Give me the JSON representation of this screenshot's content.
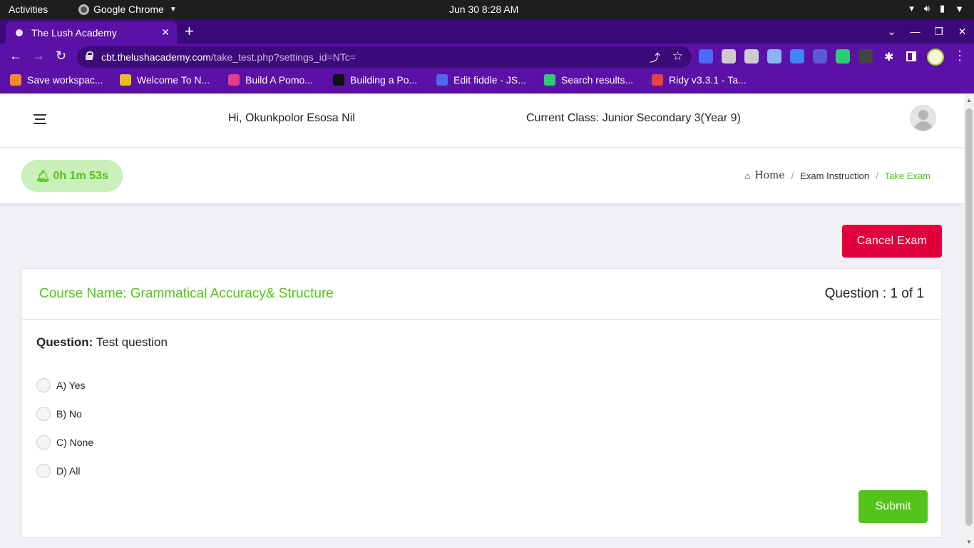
{
  "system_bar": {
    "activities": "Activities",
    "app_name": "Google Chrome",
    "clock": "Jun 30  8:28 AM"
  },
  "browser": {
    "tab_title": "The Lush Academy",
    "url_host": "cbt.thelushacademy.com",
    "url_path": "/take_test.php?settings_id=NTc=",
    "bookmarks": [
      {
        "label": "Save workspac...",
        "icon_color": "#f28c28"
      },
      {
        "label": "Welcome To N...",
        "icon_color": "#e8c21a"
      },
      {
        "label": "Build A Pomo...",
        "icon_color": "#e0408a"
      },
      {
        "label": "Building a Po...",
        "icon_color": "#111111"
      },
      {
        "label": "Edit fiddle - JS...",
        "icon_color": "#4d6ae8"
      },
      {
        "label": "Search results...",
        "icon_color": "#2ecc71"
      },
      {
        "label": "Ridy v3.3.1 - Ta...",
        "icon_color": "#e8433a"
      }
    ],
    "extension_colors": [
      "#4a6cf7",
      "#cccccc",
      "#cccccc",
      "#8ab4f8",
      "#4285f4",
      "#5b5bd6",
      "#2ecc71",
      "#444444"
    ]
  },
  "header": {
    "greeting": "Hi, Okunkpolor Esosa Nil",
    "current_class": "Current Class: Junior Secondary 3(Year 9)"
  },
  "timer": {
    "value": "0h 1m 53s",
    "icon": "bell-icon"
  },
  "breadcrumb": {
    "home": "Home",
    "instruction": "Exam Instruction",
    "current": "Take Exam"
  },
  "exam": {
    "cancel_label": "Cancel Exam",
    "course_name": "Course Name: Grammatical Accuracy& Structure",
    "question_count": "Question : 1 of 1",
    "question_label": "Question:",
    "question_text": "Test question",
    "options": [
      "A) Yes",
      "B) No",
      "C) None",
      "D) All"
    ],
    "submit_label": "Submit"
  },
  "colors": {
    "accent_green": "#52c41a",
    "danger_red": "#e0003c",
    "browser_purple": "#5b10a6"
  }
}
